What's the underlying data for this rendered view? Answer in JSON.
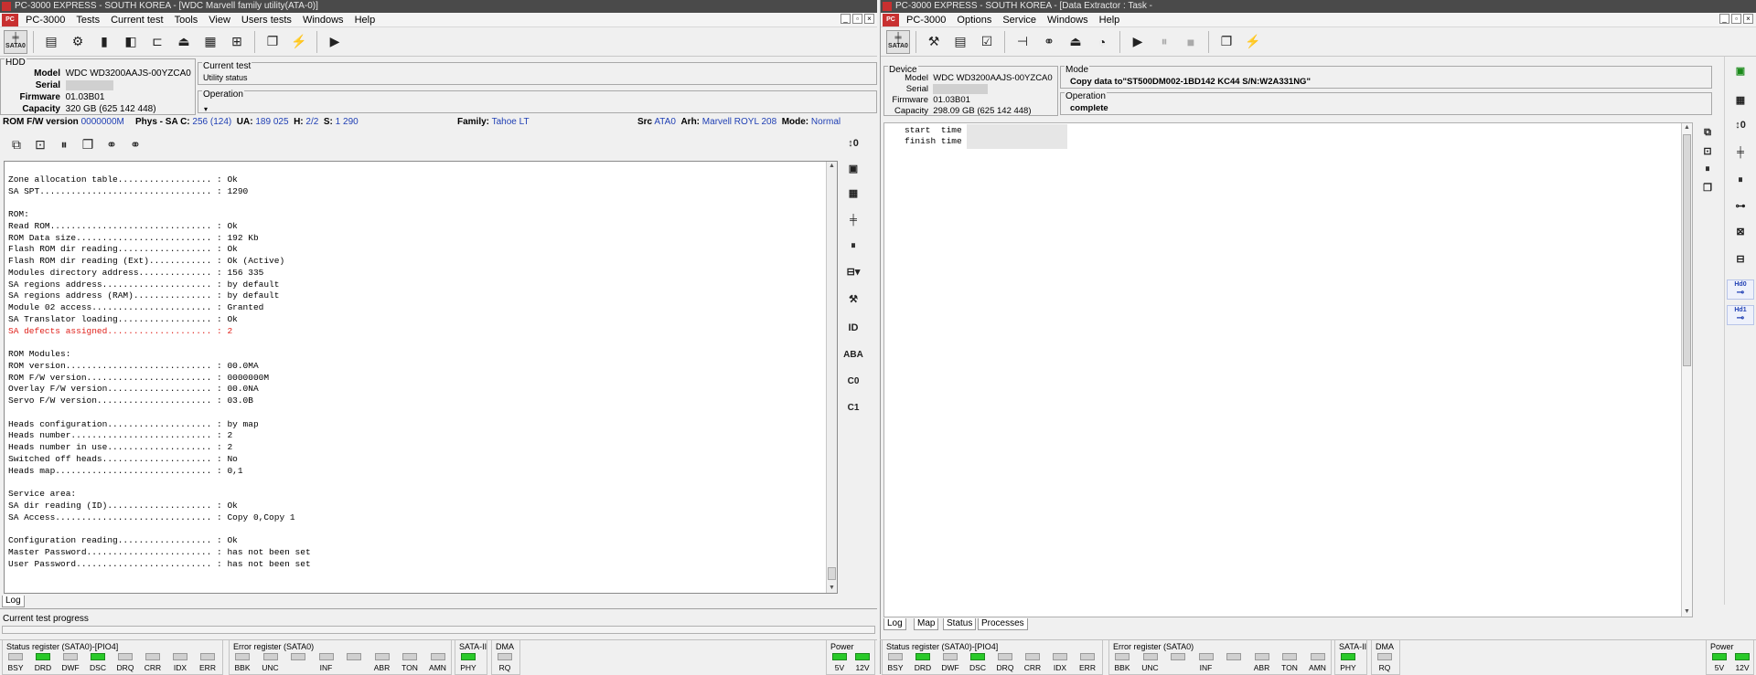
{
  "colors": {
    "title_bg": "#4a4a4a",
    "accent_blue": "#1f3fb4",
    "log_red": "#e0201a",
    "led_on": "#29c929",
    "led_off": "#d0d0d0"
  },
  "left": {
    "title": "PC-3000 EXPRESS - SOUTH KOREA - [WDC Marvell family utility(ATA-0)]",
    "menu": [
      "PC-3000",
      "Tests",
      "Current test",
      "Tools",
      "View",
      "Users tests",
      "Windows",
      "Help"
    ],
    "toolbar_icons": [
      "sata0-port-icon",
      "rom-icon",
      "gears-icon",
      "chip-icon",
      "db-icon",
      "folder-icon",
      "hdd-icon",
      "table-icon",
      "copy-icon",
      "run-icon",
      "play-icon"
    ],
    "sata_label": "SATA0",
    "hdd_legend": "HDD",
    "model_label": "Model",
    "model": "WDC WD3200AAJS-00YZCA0",
    "serial_label": "Serial",
    "firmware_label": "Firmware",
    "firmware": "01.03B01",
    "capacity_label": "Capacity",
    "capacity": "320 GB (625 142 448)",
    "current_test_legend": "Current test",
    "current_test": "Utility status",
    "operation_legend": "Operation",
    "status": {
      "rom_fw_label": "ROM F/W version",
      "rom_fw": "0000000M",
      "phys_label": "Phys - SA C:",
      "phys_c": "256 (124)",
      "ua_label": "UA:",
      "ua": "189 025",
      "h_label": "H:",
      "h": "2/2",
      "s_label": "S:",
      "s": "1 290",
      "family_label": "Family:",
      "family": "Tahoe LT",
      "src_label": "Src",
      "src": "ATA0",
      "arh_label": "Arh:",
      "arh": "Marvell ROYL 208",
      "mode_label": "Mode:",
      "mode": "Normal"
    },
    "log_lines": [
      {
        "t": "",
        "red": false
      },
      {
        "t": "Zone allocation table.................. : Ok",
        "red": false
      },
      {
        "t": "SA SPT................................. : 1290",
        "red": false
      },
      {
        "t": "",
        "red": false
      },
      {
        "t": "ROM:",
        "red": false
      },
      {
        "t": "Read ROM............................... : Ok",
        "red": false
      },
      {
        "t": "ROM Data size.......................... : 192 Kb",
        "red": false
      },
      {
        "t": "Flash ROM dir reading.................. : Ok",
        "red": false
      },
      {
        "t": "Flash ROM dir reading (Ext)............ : Ok (Active)",
        "red": false
      },
      {
        "t": "Modules directory address.............. : 156 335",
        "red": false
      },
      {
        "t": "SA regions address..................... : by default",
        "red": false
      },
      {
        "t": "SA regions address (RAM)............... : by default",
        "red": false
      },
      {
        "t": "Module 02 access....................... : Granted",
        "red": false
      },
      {
        "t": "SA Translator loading.................. : Ok",
        "red": false
      },
      {
        "t": "SA defects assigned.................... : 2",
        "red": true
      },
      {
        "t": "",
        "red": false
      },
      {
        "t": "ROM Modules:",
        "red": false
      },
      {
        "t": "ROM version............................ : 00.0MA",
        "red": false
      },
      {
        "t": "ROM F/W version........................ : 0000000M",
        "red": false
      },
      {
        "t": "Overlay F/W version.................... : 00.0NA",
        "red": false
      },
      {
        "t": "Servo F/W version...................... : 03.0B",
        "red": false
      },
      {
        "t": "",
        "red": false
      },
      {
        "t": "Heads configuration.................... : by map",
        "red": false
      },
      {
        "t": "Heads number........................... : 2",
        "red": false
      },
      {
        "t": "Heads number in use.................... : 2",
        "red": false
      },
      {
        "t": "Switched off heads..................... : No",
        "red": false
      },
      {
        "t": "Heads map.............................. : 0,1",
        "red": false
      },
      {
        "t": "",
        "red": false
      },
      {
        "t": "Service area:",
        "red": false
      },
      {
        "t": "SA dir reading (ID).................... : Ok",
        "red": false
      },
      {
        "t": "SA Access.............................. : Copy 0,Copy 1",
        "red": false
      },
      {
        "t": "",
        "red": false
      },
      {
        "t": "Configuration reading.................. : Ok",
        "red": false
      },
      {
        "t": "Master Password........................ : has not been set",
        "red": false
      },
      {
        "t": "User Password.......................... : has not been set",
        "red": false
      }
    ],
    "side_buttons": [
      "ID",
      "ABA",
      "C0",
      "C1"
    ],
    "tabs": [
      "Log"
    ],
    "progress_label": "Current test progress"
  },
  "right": {
    "title": "PC-3000 EXPRESS - SOUTH KOREA - [Data Extractor : Task -",
    "menu": [
      "PC-3000",
      "Options",
      "Service",
      "Windows",
      "Help"
    ],
    "sata_label": "SATA0",
    "device_legend": "Device",
    "model_label": "Model",
    "model": "WDC WD3200AAJS-00YZCA0",
    "serial_label": "Serial",
    "firmware_label": "Firmware",
    "firmware": "01.03B01",
    "capacity_label": "Capacity",
    "capacity": "298.09 GB (625 142 448)",
    "mode_legend": "Mode",
    "mode": "Copy data to\"ST500DM002-1BD142 KC44 S/N:W2A331NG\"",
    "operation_legend": "Operation",
    "operation": "complete",
    "log_lines": [
      "start  time",
      "finish time"
    ],
    "side_labels": [
      "Hd0",
      "Hd1"
    ],
    "tabs": [
      "Log",
      "Map",
      "Status",
      "Processes"
    ]
  },
  "registers": {
    "status_title": "Status register (SATA0)-[PIO4]",
    "status_bits": [
      {
        "n": "BSY",
        "on": false
      },
      {
        "n": "DRD",
        "on": true
      },
      {
        "n": "DWF",
        "on": false
      },
      {
        "n": "DSC",
        "on": true
      },
      {
        "n": "DRQ",
        "on": false
      },
      {
        "n": "CRR",
        "on": false
      },
      {
        "n": "IDX",
        "on": false
      },
      {
        "n": "ERR",
        "on": false
      }
    ],
    "error_title": "Error register (SATA0)",
    "error_bits": [
      {
        "n": "BBK",
        "on": false
      },
      {
        "n": "UNC",
        "on": false
      },
      {
        "n": "",
        "on": false
      },
      {
        "n": "INF",
        "on": false
      },
      {
        "n": "",
        "on": false
      },
      {
        "n": "ABR",
        "on": false
      },
      {
        "n": "TON",
        "on": false
      },
      {
        "n": "AMN",
        "on": false
      }
    ],
    "sata2_title": "SATA-II",
    "sata2_bits": [
      {
        "n": "PHY",
        "on": true
      }
    ],
    "dma_title": "DMA",
    "dma_bits": [
      {
        "n": "RQ",
        "on": false
      }
    ],
    "power_title": "Power",
    "power_bits": [
      {
        "n": "5V",
        "on": true
      },
      {
        "n": "12V",
        "on": true
      }
    ]
  }
}
